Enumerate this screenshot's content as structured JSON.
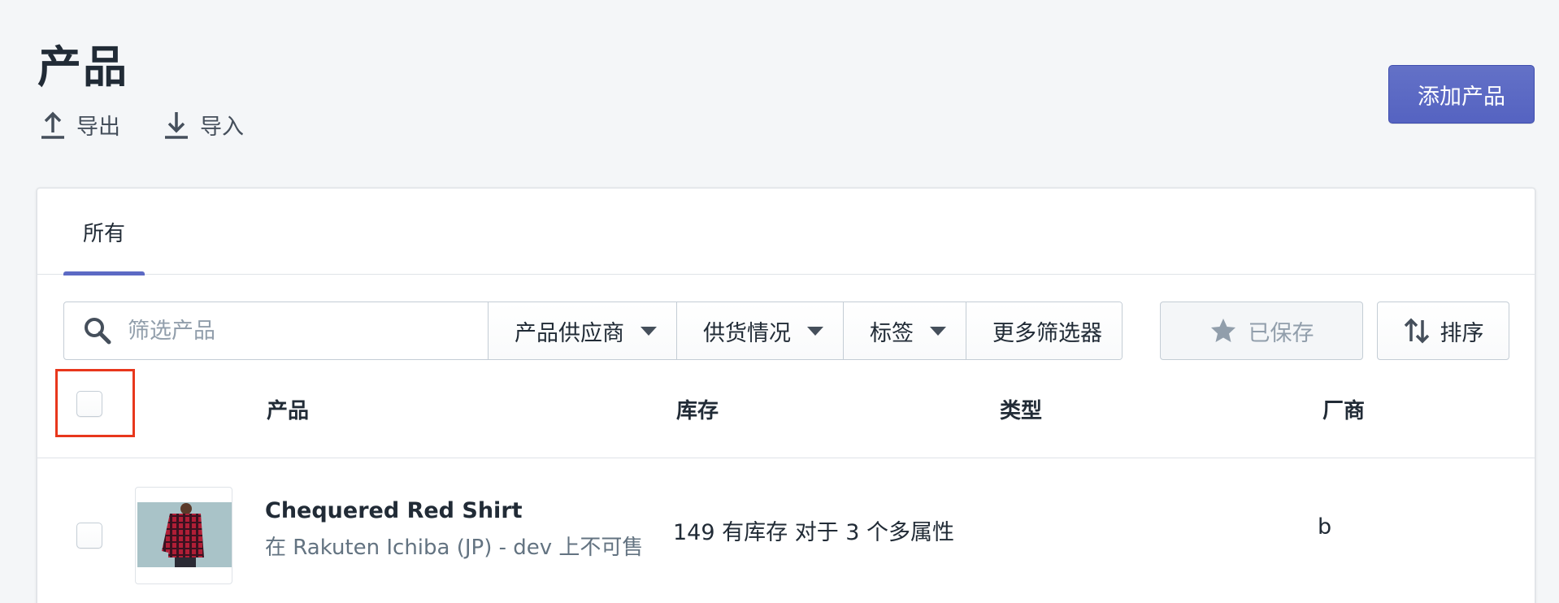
{
  "page": {
    "title": "产品",
    "export_label": "导出",
    "import_label": "导入",
    "add_product_label": "添加产品"
  },
  "tabs": [
    {
      "label": "所有",
      "active": true
    }
  ],
  "filters": {
    "search_placeholder": "筛选产品",
    "vendor_label": "产品供应商",
    "availability_label": "供货情况",
    "tags_label": "标签",
    "more_filters_label": "更多筛选器",
    "saved_label": "已保存",
    "sort_label": "排序"
  },
  "table": {
    "headers": {
      "product": "产品",
      "inventory": "库存",
      "type": "类型",
      "vendor": "厂商"
    },
    "rows": [
      {
        "name": "Chequered Red Shirt",
        "availability": "在 Rakuten Ichiba (JP) - dev 上不可售",
        "inventory": "149 有库存 对于 3 个多属性",
        "type": "",
        "vendor": "b"
      }
    ]
  },
  "colors": {
    "accent": "#5c6ac4",
    "highlight": "#e8371c",
    "background": "#f4f6f8"
  },
  "icons": [
    "export-icon",
    "import-icon",
    "search-icon",
    "star-icon",
    "sort-icon",
    "chevron-down-icon"
  ]
}
